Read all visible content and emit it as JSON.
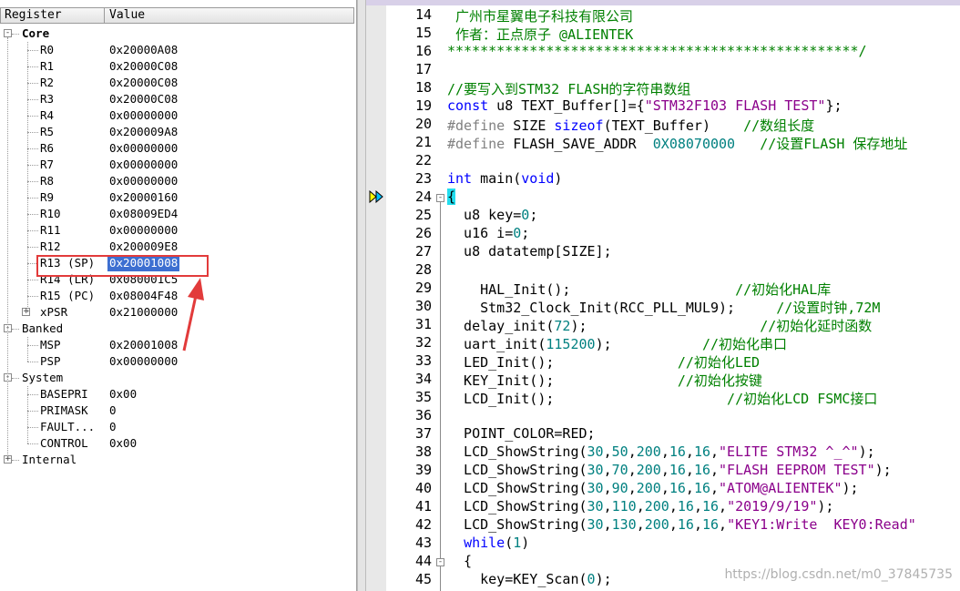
{
  "register_panel": {
    "header": {
      "register": "Register",
      "value": "Value"
    },
    "groups": {
      "core": "Core",
      "banked": "Banked",
      "system": "System",
      "internal": "Internal"
    },
    "core_regs": [
      {
        "name": "R0",
        "value": "0x20000A08"
      },
      {
        "name": "R1",
        "value": "0x20000C08"
      },
      {
        "name": "R2",
        "value": "0x20000C08"
      },
      {
        "name": "R3",
        "value": "0x20000C08"
      },
      {
        "name": "R4",
        "value": "0x00000000"
      },
      {
        "name": "R5",
        "value": "0x200009A8"
      },
      {
        "name": "R6",
        "value": "0x00000000"
      },
      {
        "name": "R7",
        "value": "0x00000000"
      },
      {
        "name": "R8",
        "value": "0x00000000"
      },
      {
        "name": "R9",
        "value": "0x20000160"
      },
      {
        "name": "R10",
        "value": "0x08009ED4"
      },
      {
        "name": "R11",
        "value": "0x00000000"
      },
      {
        "name": "R12",
        "value": "0x200009E8"
      },
      {
        "name": "R13 (SP)",
        "value": "0x20001008"
      },
      {
        "name": "R14 (LR)",
        "value": "0x080001C5"
      },
      {
        "name": "R15 (PC)",
        "value": "0x08004F48"
      },
      {
        "name": "xPSR",
        "value": "0x21000000"
      }
    ],
    "banked_regs": [
      {
        "name": "MSP",
        "value": "0x20001008"
      },
      {
        "name": "PSP",
        "value": "0x00000000"
      }
    ],
    "system_regs": [
      {
        "name": "BASEPRI",
        "value": "0x00"
      },
      {
        "name": "PRIMASK",
        "value": "0"
      },
      {
        "name": "FAULT...",
        "value": "0"
      },
      {
        "name": "CONTROL",
        "value": "0x00"
      }
    ],
    "selected_value": "0x20001008",
    "annotation_color": "#e23b3b"
  },
  "editor": {
    "lines": [
      {
        "n": "14",
        "html": "<span class=\"cm\"> 广州市星翼电子科技有限公司</span>"
      },
      {
        "n": "15",
        "html": "<span class=\"cm\"> 作者：正点原子 @ALIENTEK</span>"
      },
      {
        "n": "16",
        "html": "<span class=\"cm\">**************************************************/</span>"
      },
      {
        "n": "17",
        "html": ""
      },
      {
        "n": "18",
        "html": "<span class=\"cm\">//要写入到STM32 FLASH的字符串数组</span>"
      },
      {
        "n": "19",
        "html": "<span class=\"kw\">const</span> u8 TEXT_Buffer[]={<span class=\"st\">\"STM32F103 FLASH TEST\"</span>};"
      },
      {
        "n": "20",
        "html": "<span class=\"pp\">#define</span> SIZE <span class=\"kw\">sizeof</span>(TEXT_Buffer)    <span class=\"cm\">//数组长度</span>"
      },
      {
        "n": "21",
        "html": "<span class=\"pp\">#define</span> FLASH_SAVE_ADDR  <span class=\"nm\">0X08070000</span>   <span class=\"cm\">//设置FLASH 保存地址</span>"
      },
      {
        "n": "22",
        "html": ""
      },
      {
        "n": "23",
        "html": "<span class=\"kw\">int</span> main(<span class=\"kw\">void</span>)"
      },
      {
        "n": "24",
        "html": "<span class=\"hlb\">{</span>"
      },
      {
        "n": "25",
        "html": "  u8 key=<span class=\"nm\">0</span>;"
      },
      {
        "n": "26",
        "html": "  u16 i=<span class=\"nm\">0</span>;"
      },
      {
        "n": "27",
        "html": "  u8 datatemp[SIZE];"
      },
      {
        "n": "28",
        "html": ""
      },
      {
        "n": "29",
        "html": "    HAL_Init();                    <span class=\"cm\">//初始化HAL库</span>"
      },
      {
        "n": "30",
        "html": "    Stm32_Clock_Init(RCC_PLL_MUL9);     <span class=\"cm\">//设置时钟,72M</span>"
      },
      {
        "n": "31",
        "html": "  delay_init(<span class=\"nm\">72</span>);                     <span class=\"cm\">//初始化延时函数</span>"
      },
      {
        "n": "32",
        "html": "  uart_init(<span class=\"nm\">115200</span>);           <span class=\"cm\">//初始化串口</span>"
      },
      {
        "n": "33",
        "html": "  LED_Init();               <span class=\"cm\">//初始化LED</span>"
      },
      {
        "n": "34",
        "html": "  KEY_Init();               <span class=\"cm\">//初始化按键</span>"
      },
      {
        "n": "35",
        "html": "  LCD_Init();                     <span class=\"cm\">//初始化LCD FSMC接口</span>"
      },
      {
        "n": "36",
        "html": ""
      },
      {
        "n": "37",
        "html": "  POINT_COLOR=RED;"
      },
      {
        "n": "38",
        "html": "  LCD_ShowString(<span class=\"nm\">30</span>,<span class=\"nm\">50</span>,<span class=\"nm\">200</span>,<span class=\"nm\">16</span>,<span class=\"nm\">16</span>,<span class=\"st\">\"ELITE STM32 ^_^\"</span>);"
      },
      {
        "n": "39",
        "html": "  LCD_ShowString(<span class=\"nm\">30</span>,<span class=\"nm\">70</span>,<span class=\"nm\">200</span>,<span class=\"nm\">16</span>,<span class=\"nm\">16</span>,<span class=\"st\">\"FLASH EEPROM TEST\"</span>);"
      },
      {
        "n": "40",
        "html": "  LCD_ShowString(<span class=\"nm\">30</span>,<span class=\"nm\">90</span>,<span class=\"nm\">200</span>,<span class=\"nm\">16</span>,<span class=\"nm\">16</span>,<span class=\"st\">\"ATOM@ALIENTEK\"</span>);"
      },
      {
        "n": "41",
        "html": "  LCD_ShowString(<span class=\"nm\">30</span>,<span class=\"nm\">110</span>,<span class=\"nm\">200</span>,<span class=\"nm\">16</span>,<span class=\"nm\">16</span>,<span class=\"st\">\"2019/9/19\"</span>);"
      },
      {
        "n": "42",
        "html": "  LCD_ShowString(<span class=\"nm\">30</span>,<span class=\"nm\">130</span>,<span class=\"nm\">200</span>,<span class=\"nm\">16</span>,<span class=\"nm\">16</span>,<span class=\"st\">\"KEY1:Write  KEY0:Read\"</span>"
      },
      {
        "n": "43",
        "html": "  <span class=\"kw\">while</span>(<span class=\"nm\">1</span>)"
      },
      {
        "n": "44",
        "html": "  {"
      },
      {
        "n": "45",
        "html": "    key=KEY_Scan(<span class=\"nm\">0</span>);"
      }
    ],
    "watermark": "https://blog.csdn.net/m0_37845735"
  }
}
